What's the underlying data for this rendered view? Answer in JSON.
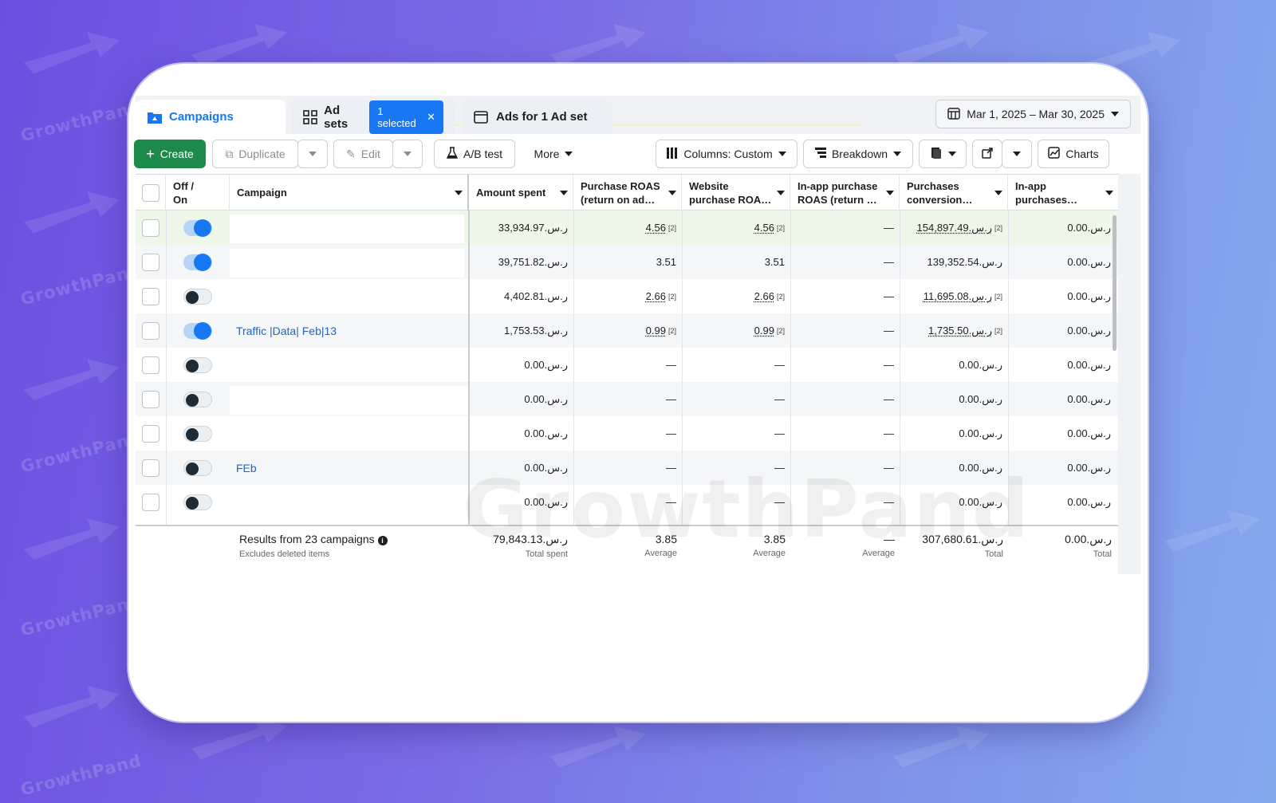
{
  "background": {
    "watermark_text": "GrowthPand"
  },
  "tabs": {
    "campaigns": "Campaigns",
    "ad_sets": "Ad sets",
    "selected_badge": "1 selected",
    "ads": "Ads for 1 Ad set"
  },
  "date_range": "Mar 1, 2025 – Mar 30, 2025",
  "toolbar": {
    "create": "Create",
    "duplicate": "Duplicate",
    "edit": "Edit",
    "ab_test": "A/B test",
    "more": "More",
    "columns": "Columns: Custom",
    "breakdown": "Breakdown",
    "charts": "Charts"
  },
  "columns": [
    "Off /\nOn",
    "Campaign",
    "Amount spent",
    "Purchase ROAS\n(return on ad…",
    "Website\npurchase ROA…",
    "In-app purchase\nROAS (return …",
    "Purchases\nconversion…",
    "In-app\npurchases…"
  ],
  "rows": [
    {
      "toggle": "on",
      "campaign": "",
      "amount": "33,934.97.ر.س",
      "roas": "4.56",
      "roas_sup": "[2]",
      "web_roas": "4.56",
      "web_sup": "[2]",
      "inapp_roas": "—",
      "conv": "154,897.49.ر.س",
      "conv_sup": "[2]",
      "inapp": "0.00.ر.س"
    },
    {
      "toggle": "on",
      "campaign": "",
      "amount": "39,751.82.ر.س",
      "roas": "3.51",
      "roas_sup": "",
      "web_roas": "3.51",
      "web_sup": "",
      "inapp_roas": "—",
      "conv": "139,352.54.ر.س",
      "conv_sup": "",
      "inapp": "0.00.ر.س"
    },
    {
      "toggle": "off",
      "campaign": "",
      "amount": "4,402.81.ر.س",
      "roas": "2.66",
      "roas_sup": "[2]",
      "web_roas": "2.66",
      "web_sup": "[2]",
      "inapp_roas": "—",
      "conv": "11,695.08.ر.س",
      "conv_sup": "[2]",
      "inapp": "0.00.ر.س"
    },
    {
      "toggle": "on",
      "campaign": "Traffic |Data| Feb|13",
      "amount": "1,753.53.ر.س",
      "roas": "0.99",
      "roas_sup": "[2]",
      "web_roas": "0.99",
      "web_sup": "[2]",
      "inapp_roas": "—",
      "conv": "1,735.50.ر.س",
      "conv_sup": "[2]",
      "inapp": "0.00.ر.س"
    },
    {
      "toggle": "off",
      "campaign": "",
      "amount": "0.00.ر.س",
      "roas": "—",
      "roas_sup": "",
      "web_roas": "—",
      "web_sup": "",
      "inapp_roas": "—",
      "conv": "0.00.ر.س",
      "conv_sup": "",
      "inapp": "0.00.ر.س"
    },
    {
      "toggle": "off",
      "campaign": "",
      "amount": "0.00.ر.س",
      "roas": "—",
      "roas_sup": "",
      "web_roas": "—",
      "web_sup": "",
      "inapp_roas": "—",
      "conv": "0.00.ر.س",
      "conv_sup": "",
      "inapp": "0.00.ر.س"
    },
    {
      "toggle": "off",
      "campaign": "",
      "amount": "0.00.ر.س",
      "roas": "—",
      "roas_sup": "",
      "web_roas": "—",
      "web_sup": "",
      "inapp_roas": "—",
      "conv": "0.00.ر.س",
      "conv_sup": "",
      "inapp": "0.00.ر.س"
    },
    {
      "toggle": "off",
      "campaign": "FEb",
      "amount": "0.00.ر.س",
      "roas": "—",
      "roas_sup": "",
      "web_roas": "—",
      "web_sup": "",
      "inapp_roas": "—",
      "conv": "0.00.ر.س",
      "conv_sup": "",
      "inapp": "0.00.ر.س"
    },
    {
      "toggle": "off",
      "campaign": "",
      "amount": "0.00.ر.س",
      "roas": "—",
      "roas_sup": "",
      "web_roas": "—",
      "web_sup": "",
      "inapp_roas": "—",
      "conv": "0.00.ر.س",
      "conv_sup": "",
      "inapp": "0.00.ر.س"
    }
  ],
  "footer": {
    "results": "Results from 23 campaigns",
    "excludes": "Excludes deleted items",
    "amount": "79,843.13.ر.س",
    "amount_label": "Total spent",
    "roas": "3.85",
    "roas_label": "Average",
    "web_roas": "3.85",
    "web_roas_label": "Average",
    "inapp_roas": "—",
    "inapp_roas_label": "Average",
    "conv": "307,680.61.ر.س",
    "conv_label": "Total",
    "inapp": "0.00.ر.س",
    "inapp_label": "Total"
  },
  "colors": {
    "accent": "#1877f2",
    "create_green": "#1b8a4b",
    "link": "#1b66c9"
  }
}
